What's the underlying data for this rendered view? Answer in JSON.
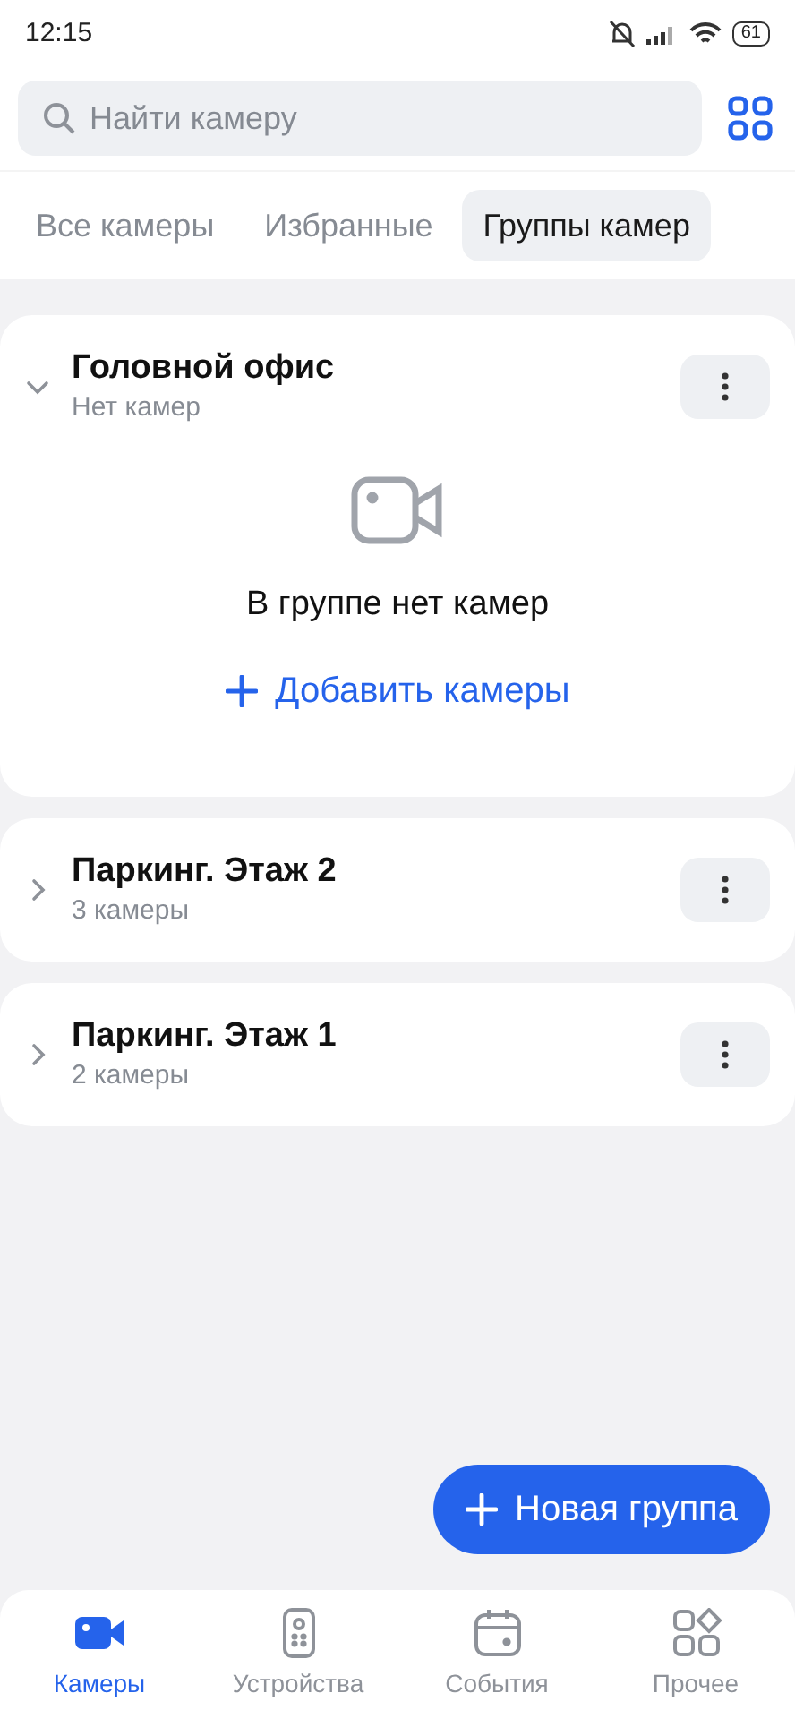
{
  "status_bar": {
    "time": "12:15",
    "battery": "61"
  },
  "search": {
    "placeholder": "Найти камеру"
  },
  "tabs": [
    {
      "label": "Все камеры",
      "selected": false
    },
    {
      "label": "Избранные",
      "selected": false
    },
    {
      "label": "Группы камер",
      "selected": true
    }
  ],
  "groups": [
    {
      "name": "Головной офис",
      "count": "Нет камер",
      "expanded": true,
      "empty_text": "В группе нет камер",
      "add_label": "Добавить камеры"
    },
    {
      "name": "Паркинг. Этаж 2",
      "count": "3 камеры",
      "expanded": false
    },
    {
      "name": "Паркинг. Этаж 1",
      "count": "2 камеры",
      "expanded": false
    }
  ],
  "fab": {
    "label": "Новая группа"
  },
  "bottom_nav": [
    {
      "label": "Камеры",
      "selected": true
    },
    {
      "label": "Устройства",
      "selected": false
    },
    {
      "label": "События",
      "selected": false
    },
    {
      "label": "Прочее",
      "selected": false
    }
  ]
}
